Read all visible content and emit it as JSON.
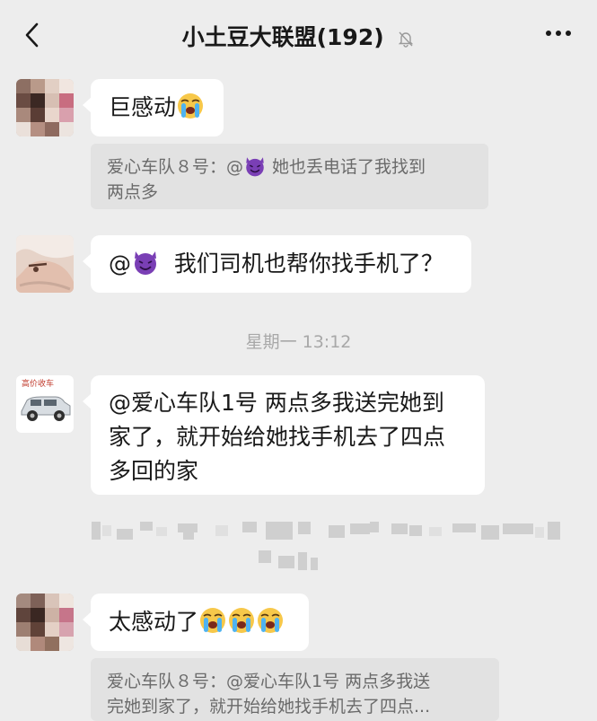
{
  "header": {
    "title": "小土豆大联盟(192)"
  },
  "icons": {
    "back": "back-chevron-icon",
    "mute": "bell-muted-icon",
    "more": "more-dots-icon",
    "devil_emoji": "smiling-devil-emoji",
    "crying_emoji": "loudly-crying-emoji"
  },
  "messages": [
    {
      "text": "巨感动"
    },
    {
      "quote": "爱心车队８号：@ 她也丢电话了我找到两点多"
    },
    {
      "text_prefix": "@",
      "text": " 我们司机也帮你找手机了？"
    },
    {
      "timestamp": "星期一 13:12"
    },
    {
      "text": "@爱心车队1号 两点多我送完她到家了，就开始给她找手机去了四点多回的家"
    },
    {
      "text": "太感动了"
    },
    {
      "quote": "爱心车队８号：@爱心车队1号 两点多我送完她到家了，就开始给她找手机去了四点..."
    }
  ],
  "msg": {
    "m1": "巨感动",
    "q1_a": "爱心车队８号：@",
    "q1_b": " 她也丢电话了我找到",
    "q1_c": "两点多",
    "m2_prefix": "@",
    "m2": "  我们司机也帮你找手机了？",
    "time": "星期一 13:12",
    "m3_l1": "@爱心车队1号 两点多我送完她到",
    "m3_l2": "家了，就开始给她找手机去了四点",
    "m3_l3": "多回的家",
    "m4": "太感动了",
    "q2_l1": "爱心车队８号：@爱心车队1号 两点多我送",
    "q2_l2": "完她到家了，就开始给她找手机去了四点..."
  },
  "colors": {
    "background": "#ededed",
    "bubble": "#ffffff",
    "quote_bg": "#e2e2e2",
    "quote_text": "#6b6b6b",
    "timestamp": "#a8a8a8",
    "devil_purple": "#7a3fb5",
    "emoji_yellow": "#f7c84a"
  }
}
